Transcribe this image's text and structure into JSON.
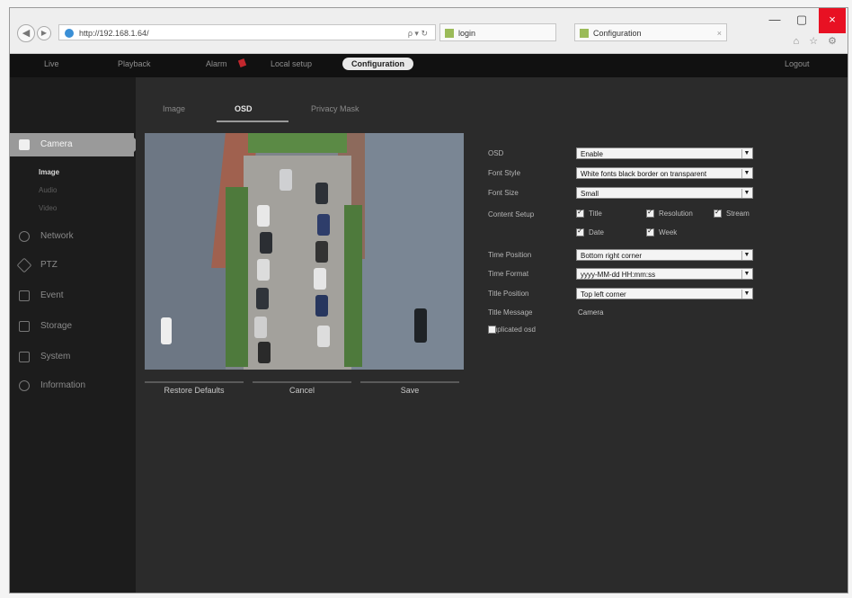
{
  "browser": {
    "address": "http://192.168.1.64/",
    "address_tools": "ρ ▾ ↻",
    "tab_search": "login",
    "tab_title": "Configuration",
    "minimize": "—",
    "maximize": "▢",
    "close": "×",
    "right_icons": "⌂ ☆ ⚙"
  },
  "topnav": {
    "items": [
      "Live",
      "Playback",
      "Alarm",
      "Local setup",
      "Configuration"
    ],
    "logout": "Logout"
  },
  "sidebar": {
    "items": [
      "Camera",
      "Network",
      "PTZ",
      "Event",
      "Storage",
      "System",
      "Information"
    ],
    "subitems": [
      "Image",
      "Audio",
      "Video"
    ]
  },
  "tabs": [
    "Image",
    "OSD",
    "Privacy Mask"
  ],
  "osd": {
    "osd_label": "OSD",
    "osd_value": "Enable",
    "font_style_label": "Font Style",
    "font_style_value": "White fonts black border on transparent",
    "font_size_label": "Font Size",
    "font_size_value": "Small",
    "content_label": "Content Setup",
    "chk_title": "Title",
    "chk_resolution": "Resolution",
    "chk_stream": "Stream",
    "chk_date": "Date",
    "chk_week": "Week",
    "time_position_label": "Time Position",
    "time_position_value": "Bottom right corner",
    "time_format_label": "Time Format",
    "time_format_value": "yyyy-MM-dd HH:mm:ss",
    "title_position_label": "Title Position",
    "title_position_value": "Top left corner",
    "title_message_label": "Title Message",
    "title_message_value": "Camera",
    "duplicate_label": "Duplicated osd"
  },
  "buttons": {
    "restore": "Restore Defaults",
    "cancel": "Cancel",
    "save": "Save"
  },
  "colors": {
    "accent_close": "#e81123",
    "active_sidebar": "#9a9a9a",
    "background": "#2b2b2b"
  }
}
